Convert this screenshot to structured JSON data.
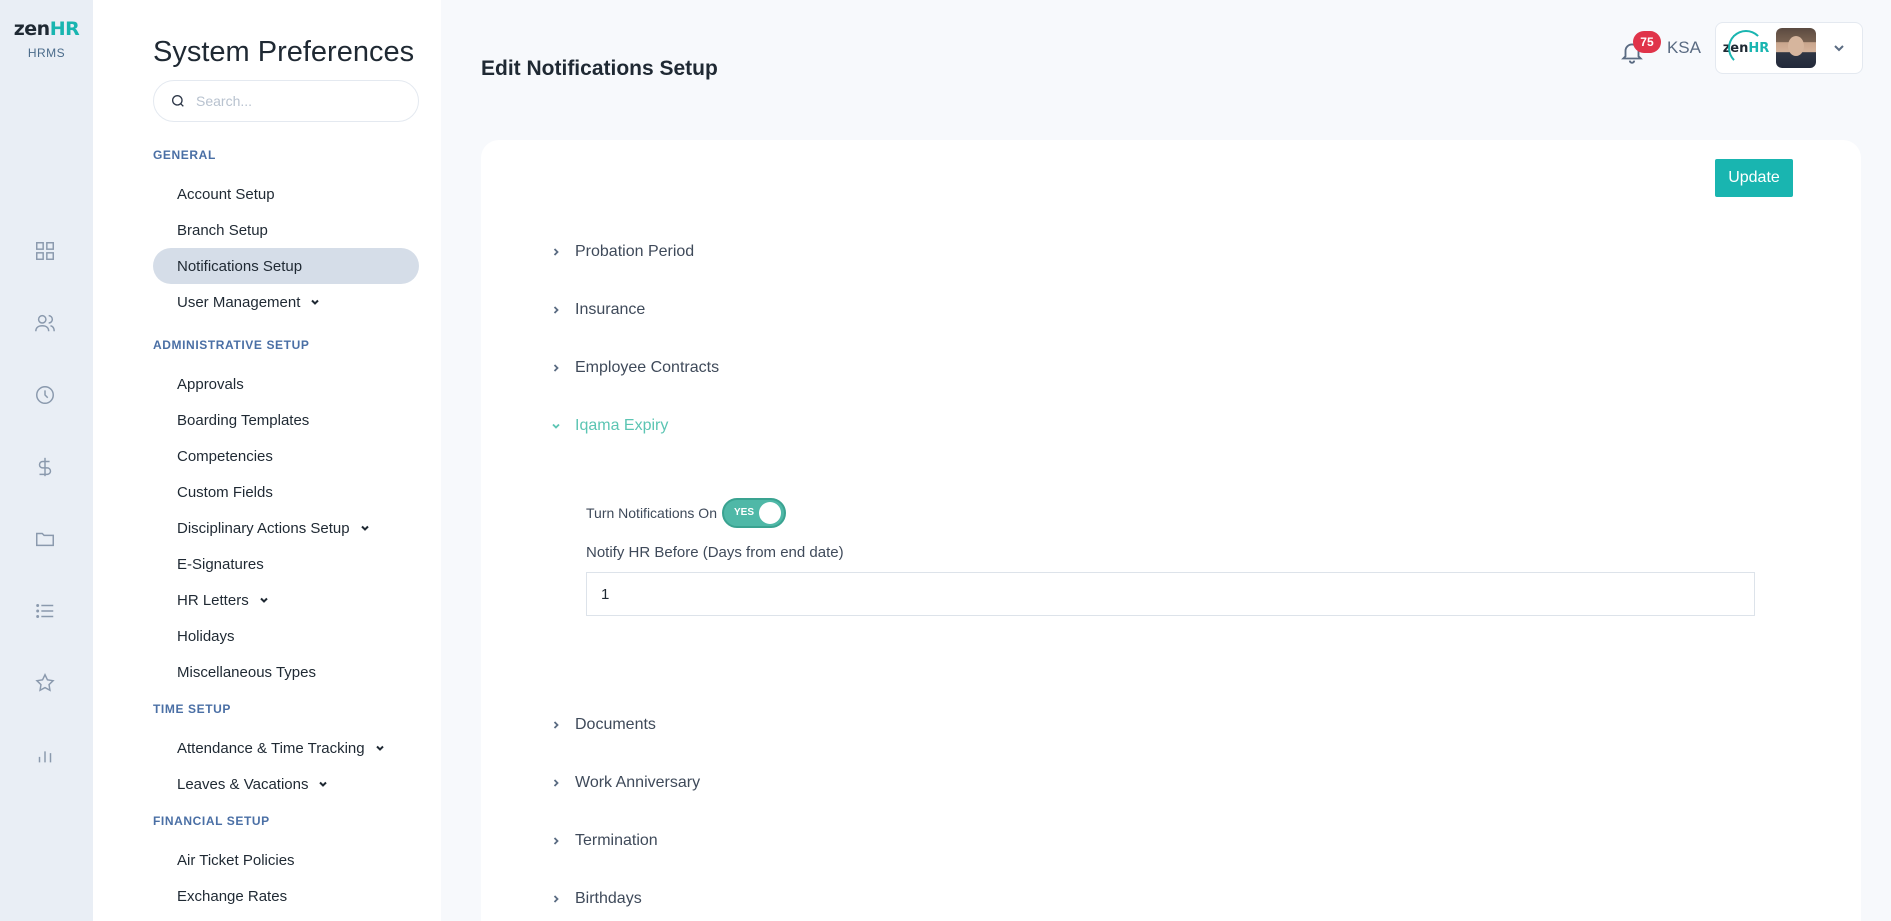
{
  "brand": {
    "word_main": "zen",
    "word_accent": "HR",
    "sub": "HRMS",
    "accent_color": "#19b5b0"
  },
  "rail": {
    "icons": [
      "grid-icon",
      "people-icon",
      "clock-icon",
      "dollar-icon",
      "folder-icon",
      "list-icon",
      "star-icon",
      "chart-icon"
    ]
  },
  "prefs": {
    "title": "System Preferences",
    "search_placeholder": "Search...",
    "sections": [
      {
        "label": "GENERAL",
        "items": [
          {
            "label": "Account Setup"
          },
          {
            "label": "Branch Setup"
          },
          {
            "label": "Notifications Setup",
            "active": true
          },
          {
            "label": "User Management",
            "expandable": true
          }
        ]
      },
      {
        "label": "ADMINISTRATIVE SETUP",
        "items": [
          {
            "label": "Approvals"
          },
          {
            "label": "Boarding Templates"
          },
          {
            "label": "Competencies"
          },
          {
            "label": "Custom Fields"
          },
          {
            "label": "Disciplinary Actions Setup",
            "expandable": true
          },
          {
            "label": "E-Signatures"
          },
          {
            "label": "HR Letters",
            "expandable": true
          },
          {
            "label": "Holidays"
          },
          {
            "label": "Miscellaneous Types"
          }
        ]
      },
      {
        "label": "TIME SETUP",
        "items": [
          {
            "label": "Attendance & Time Tracking",
            "expandable": true
          },
          {
            "label": "Leaves & Vacations",
            "expandable": true
          }
        ]
      },
      {
        "label": "FINANCIAL SETUP",
        "items": [
          {
            "label": "Air Ticket Policies"
          },
          {
            "label": "Exchange Rates"
          }
        ]
      }
    ]
  },
  "header": {
    "page_title": "Edit Notifications Setup",
    "notification_count": "75",
    "country": "KSA",
    "account_logo_main": "zen",
    "account_logo_accent": "HR"
  },
  "main": {
    "update_label": "Update",
    "sections": [
      {
        "label": "Probation Period",
        "open": false
      },
      {
        "label": "Insurance",
        "open": false
      },
      {
        "label": "Employee Contracts",
        "open": false
      },
      {
        "label": "Iqama Expiry",
        "open": true
      },
      {
        "label": "Documents",
        "open": false
      },
      {
        "label": "Work Anniversary",
        "open": false
      },
      {
        "label": "Termination",
        "open": false
      },
      {
        "label": "Birthdays",
        "open": false
      }
    ],
    "expanded": {
      "toggle_label": "Turn Notifications On",
      "toggle_state": "YES",
      "field_label": "Notify HR Before (Days from end date)",
      "field_value": "1"
    }
  }
}
